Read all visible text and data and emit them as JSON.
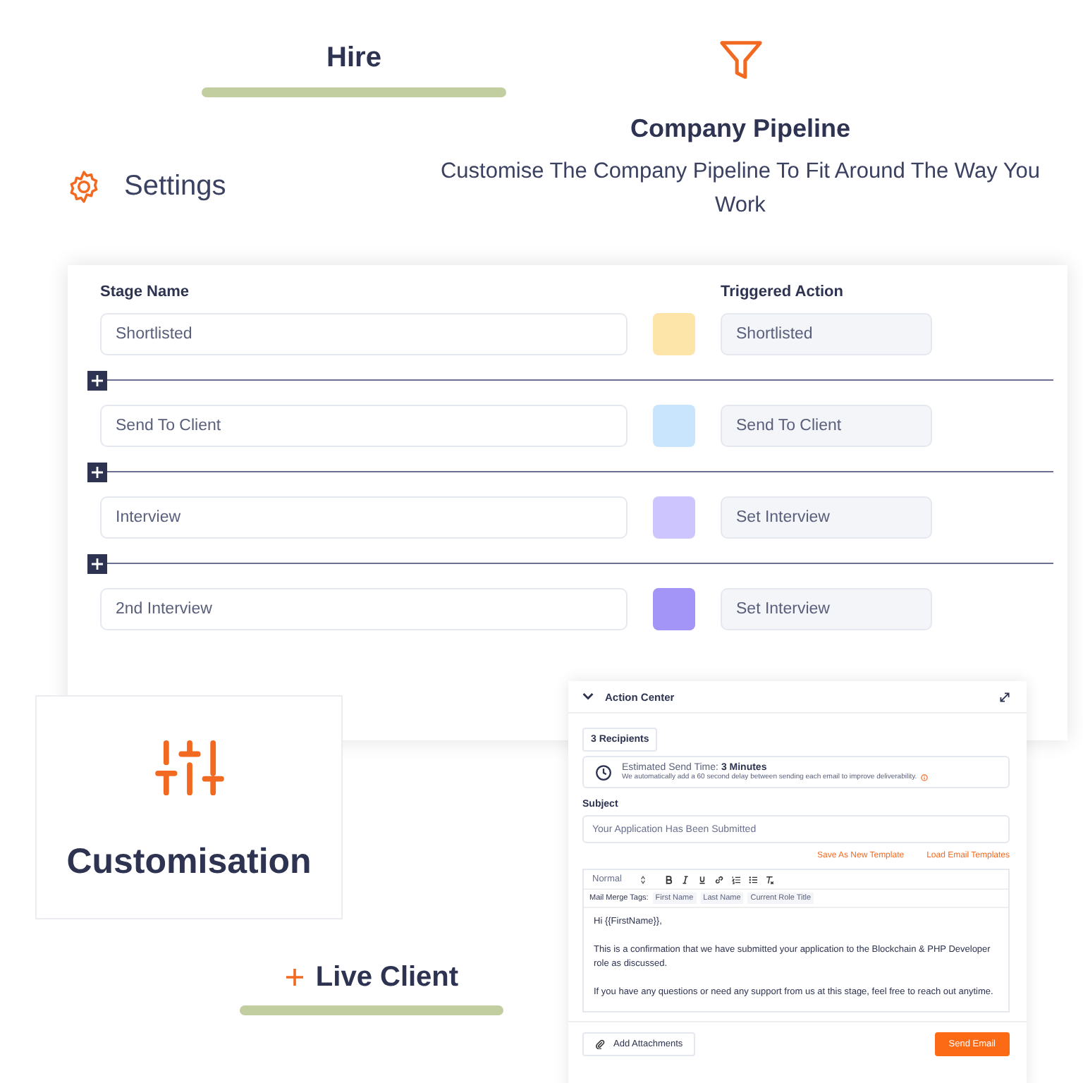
{
  "tabs": [
    {
      "label": "Hire",
      "selected": true
    },
    {
      "label": "Live Client",
      "selected": true
    }
  ],
  "settings": {
    "label": "Settings"
  },
  "feature": {
    "title": "Company Pipeline",
    "description": "Customise The Company Pipeline To Fit Around The Way You Work"
  },
  "pipeline": {
    "columns": [
      "Stage Name",
      "Triggered Action"
    ],
    "stages": [
      {
        "name": "Shortlisted",
        "color": "#fde4a8",
        "action": "Shortlisted"
      },
      {
        "name": "Send To Client",
        "color": "#c9e5fd",
        "action": "Send To Client"
      },
      {
        "name": "Interview",
        "color": "#cdc5fd",
        "action": "Set Interview"
      },
      {
        "name": "2nd Interview",
        "color": "#a394f7",
        "action": "Set Interview"
      }
    ]
  },
  "customisation_card": {
    "title": "Customisation"
  },
  "action_center": {
    "title": "Action Center",
    "recipients": "3 Recipients",
    "estimate_label": "Estimated Send Time:",
    "estimate_value": "3 Minutes",
    "estimate_note": "We automatically add a 60 second delay between sending each email to improve deliverability.",
    "subject_label": "Subject",
    "subject": "Your Application Has Been Submitted",
    "links": [
      "Save As New Template",
      "Load Email Templates"
    ],
    "format": "Normal",
    "merge_label": "Mail Merge Tags:",
    "merge_tags": [
      "First Name",
      "Last Name",
      "Current Role Title"
    ],
    "body": [
      "Hi {{FirstName}},",
      "This is a confirmation that we have submitted your application to the Blockchain & PHP Developer role as discussed.",
      "If you have any questions or need any support from us at this stage, feel free to reach out anytime."
    ],
    "attach_button": "Add Attachments",
    "send_button": "Send Email"
  }
}
